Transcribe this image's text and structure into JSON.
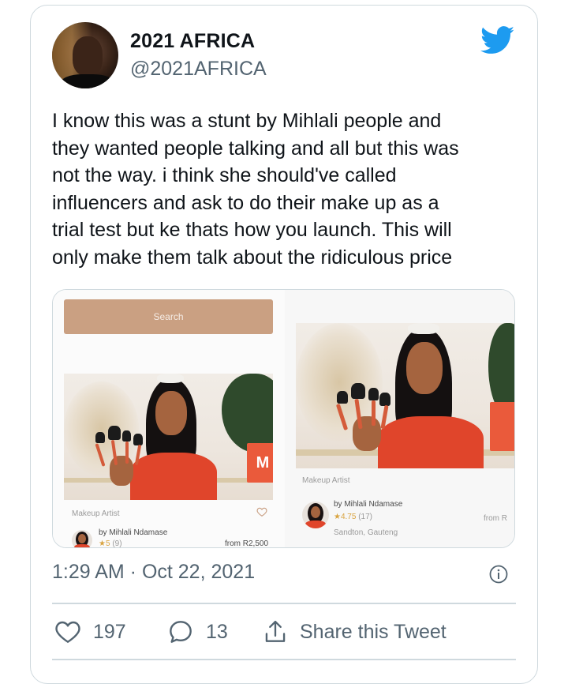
{
  "author": {
    "display_name": "2021 AFRICA",
    "handle": "@2021AFRICA"
  },
  "tweet": {
    "text_lines": [
      "I know this was a stunt by Mihlali people and",
      "they wanted people talking and all but this was",
      "not the way. i think she should've called",
      "influencers and ask to do their make up as a",
      "trial test but ke thats how you launch. This will",
      "only make them talk about the ridiculous price"
    ],
    "timestamp": "1:29 AM · Oct 22, 2021"
  },
  "media": {
    "left": {
      "search_label": "Search",
      "category": "Makeup Artist",
      "by_line": "by Mihlali Ndamase",
      "rating": "★5",
      "rating_count": "(9)",
      "price": "from R2,500"
    },
    "right": {
      "category": "Makeup Artist",
      "by_line": "by Mihlali Ndamase",
      "rating": "★4.75",
      "rating_count": "(17)",
      "location": "Sandton, Gauteng",
      "price": "from R"
    },
    "box_logo": "M"
  },
  "actions": {
    "likes": "197",
    "replies": "13",
    "share_label": "Share this Tweet"
  },
  "colors": {
    "twitter_blue": "#1d9bf0",
    "text_primary": "#0f1419",
    "text_secondary": "#536471",
    "border": "#cfd9de",
    "search_bar": "#caa082"
  },
  "icons": [
    "twitter-bird-icon",
    "info-icon",
    "heart-icon",
    "reply-icon",
    "share-icon"
  ]
}
